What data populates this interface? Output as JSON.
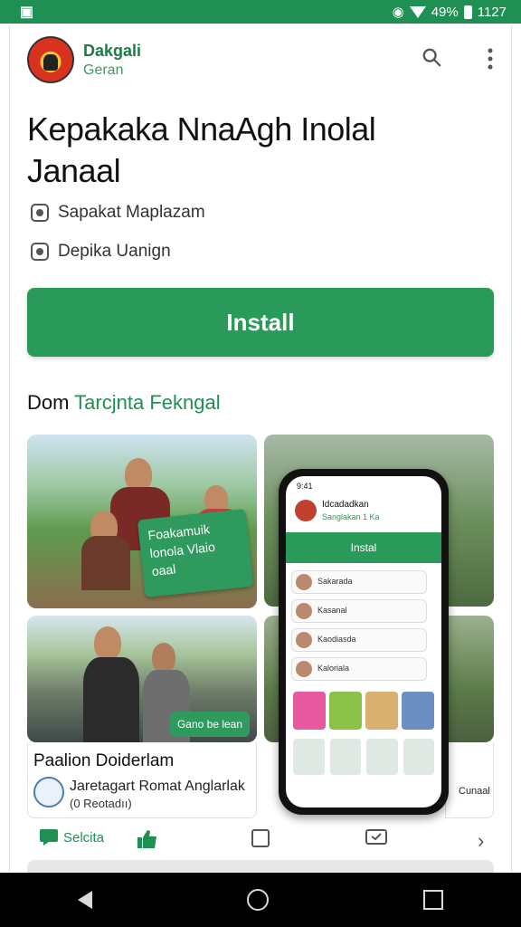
{
  "status_bar": {
    "left_icon": "app-notification-icon",
    "battery_text": "49%",
    "time": "1127"
  },
  "app_header": {
    "brand": "Dakgali",
    "brand_sub": "Geran",
    "search_icon": "search-icon",
    "menu_icon": "more-vert-icon"
  },
  "app_title": {
    "line1": "Kepakaka NnaAgh Inolal",
    "line2": "Janaal"
  },
  "meta": [
    {
      "icon": "developer-icon",
      "text": "Sapakat Maplazam"
    },
    {
      "icon": "category-icon",
      "text": "Depika Uanign"
    }
  ],
  "install_button": {
    "label": "Install"
  },
  "section": {
    "title_a": "Dom",
    "title_b": "Tarcjnta Fekngal"
  },
  "gallery": {
    "card1_overlay": "Foakamuik lonola Vlaio oaal",
    "card2_pill": "Gano be lean",
    "card1_caption_title": "Paalion Doiderlam",
    "card1_caption_sub": "Jaretagart Romat Anglarlak",
    "card1_caption_detail": "(0 Reotadıı)",
    "phone_bar_label": "Instal",
    "phone_status": "9:41",
    "phone_header_title": "Idcadadkan",
    "phone_header_sub": "Sanglakan 1 Ka",
    "phone_rows": [
      "Sakarada",
      "Kasanal",
      "Kaodiasda",
      "Kaloriala"
    ],
    "right_caption": "Cunaal"
  },
  "bottom_tabs": [
    {
      "icon": "chat-icon",
      "label": "Selcita"
    },
    {
      "icon": "thumb-up-icon",
      "label": ""
    },
    {
      "icon": "square-icon",
      "label": ""
    },
    {
      "icon": "message-box-icon",
      "label": ""
    },
    {
      "icon": "chevron-right-icon",
      "label": ""
    }
  ],
  "colors": {
    "status_bar": "#1f8f53",
    "accent": "#2a9a5a",
    "brand_text": "#1f7a45"
  }
}
